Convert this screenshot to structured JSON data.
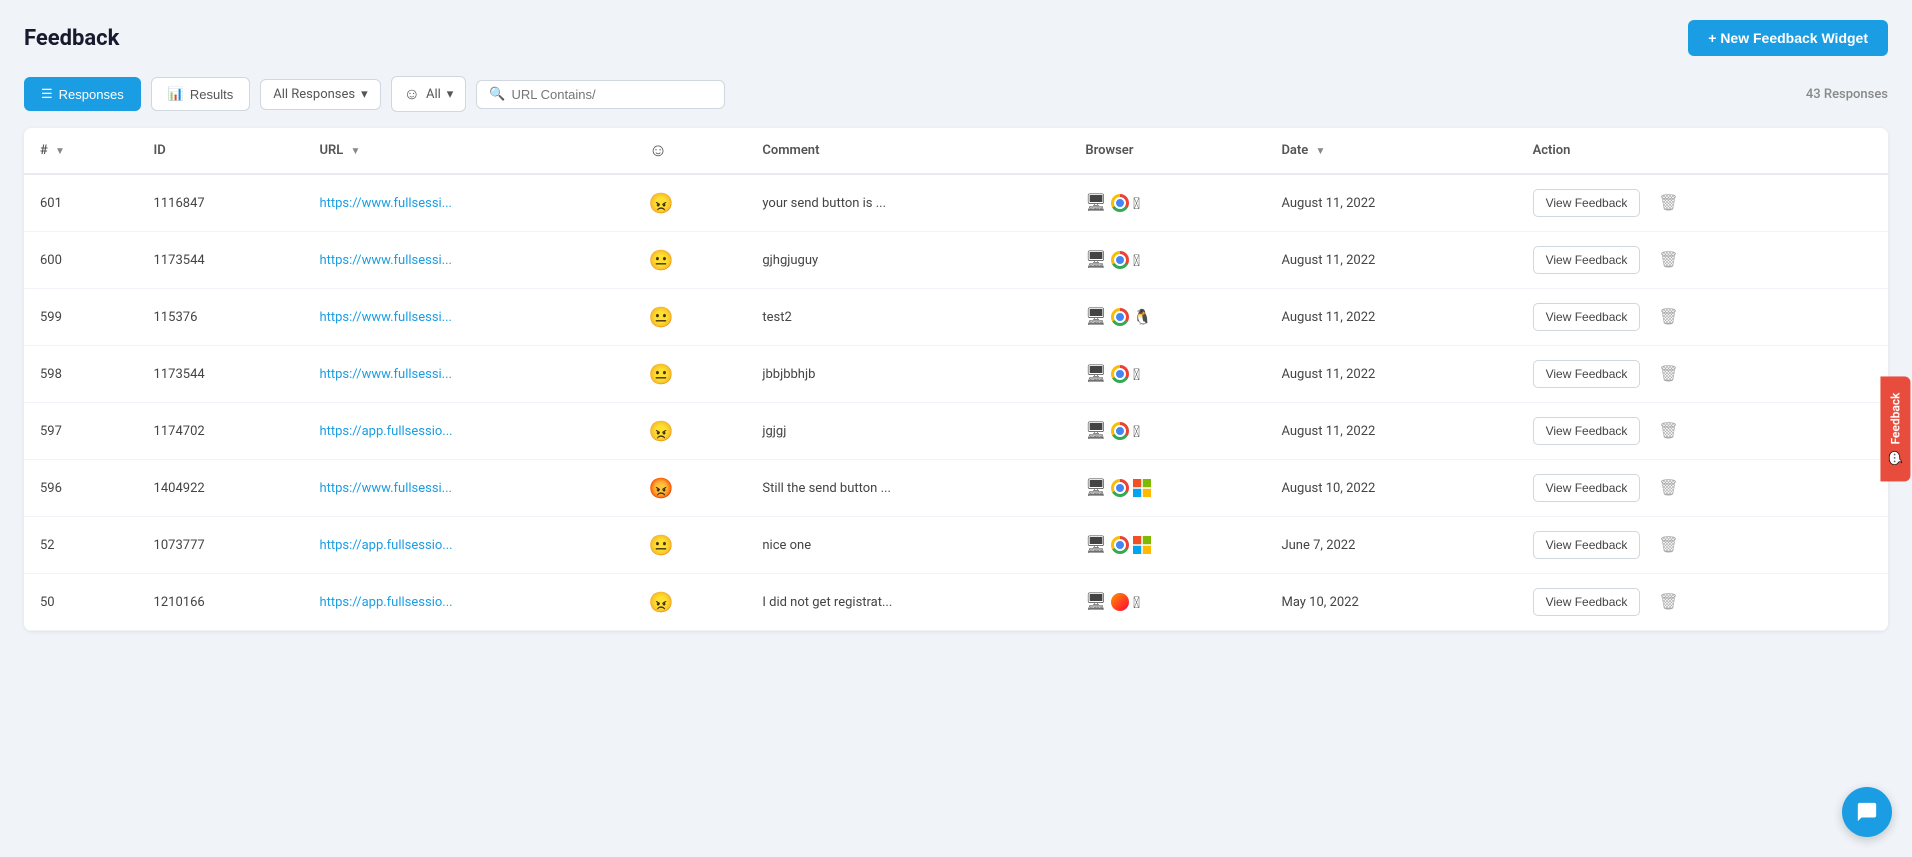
{
  "header": {
    "title": "Feedback",
    "new_widget_btn_label": "+ New Feedback Widget"
  },
  "toolbar": {
    "responses_tab": "Responses",
    "results_tab": "Results",
    "filter_label": "All Responses",
    "all_label": "All",
    "search_placeholder": "URL Contains/",
    "response_count": "43 Responses"
  },
  "table": {
    "columns": [
      "#",
      "ID",
      "URL",
      "😊",
      "Comment",
      "Browser",
      "Date",
      "Action"
    ],
    "view_feedback_label": "View Feedback",
    "rows": [
      {
        "num": "601",
        "id": "1116847",
        "url": "https://www.fullsessi...",
        "emoji": "😠",
        "comment": "your send button is ...",
        "device": "monitor",
        "browser": "chrome",
        "os": "apple",
        "date": "August 11, 2022"
      },
      {
        "num": "600",
        "id": "1173544",
        "url": "https://www.fullsessi...",
        "emoji": "😐",
        "comment": "gjhgjuguy",
        "device": "monitor",
        "browser": "chrome",
        "os": "apple",
        "date": "August 11, 2022"
      },
      {
        "num": "599",
        "id": "115376",
        "url": "https://www.fullsessi...",
        "emoji": "😐",
        "comment": "test2",
        "device": "monitor",
        "browser": "chrome",
        "os": "linux",
        "date": "August 11, 2022"
      },
      {
        "num": "598",
        "id": "1173544",
        "url": "https://www.fullsessi...",
        "emoji": "😐",
        "comment": "jbbjbbhjb",
        "device": "monitor",
        "browser": "chrome",
        "os": "apple",
        "date": "August 11, 2022"
      },
      {
        "num": "597",
        "id": "1174702",
        "url": "https://app.fullsessio...",
        "emoji": "😠",
        "comment": "jgjgj",
        "device": "monitor",
        "browser": "chrome",
        "os": "apple",
        "date": "August 11, 2022"
      },
      {
        "num": "596",
        "id": "1404922",
        "url": "https://www.fullsessi...",
        "emoji": "😡",
        "comment": "Still the send button ...",
        "device": "monitor",
        "browser": "chrome",
        "os": "windows",
        "date": "August 10, 2022"
      },
      {
        "num": "52",
        "id": "1073777",
        "url": "https://app.fullsessio...",
        "emoji": "😐",
        "comment": "nice one",
        "device": "monitor",
        "browser": "chrome",
        "os": "windows",
        "date": "June 7, 2022"
      },
      {
        "num": "50",
        "id": "1210166",
        "url": "https://app.fullsessio...",
        "emoji": "😠",
        "comment": "I did not get registrat...",
        "device": "monitor",
        "browser": "firefox",
        "os": "apple",
        "date": "May 10, 2022"
      }
    ]
  },
  "side_tab": {
    "label": "Feedback"
  },
  "icons": {
    "plus": "+",
    "sort_asc": "▼",
    "sort_date": "▼",
    "search": "🔍",
    "chevron_down": "▾",
    "smiley": "☺",
    "trash": "🗑",
    "chat": "💬"
  }
}
